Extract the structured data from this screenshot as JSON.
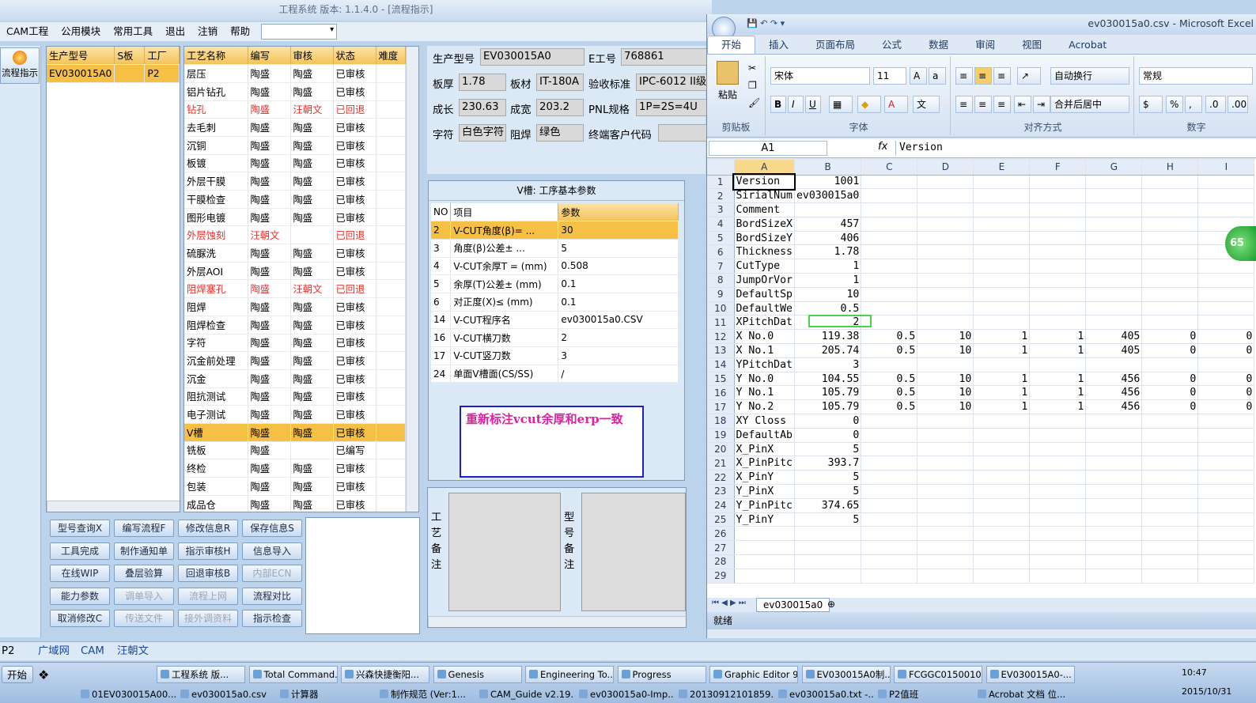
{
  "app": {
    "title": "工程系统   版本: 1.1.4.0 - [流程指示]"
  },
  "menu": [
    "CAM工程",
    "公用模块",
    "常用工具",
    "退出",
    "注销",
    "帮助"
  ],
  "left": {
    "flow_btn": "流程指示"
  },
  "models": {
    "headers": [
      "生产型号",
      "S板",
      "工厂"
    ],
    "rows": [
      [
        "EV030015A0",
        "",
        "P2"
      ]
    ]
  },
  "process": {
    "headers": [
      "工艺名称",
      "编写",
      "审核",
      "状态",
      "难度"
    ],
    "rows": [
      {
        "c": [
          "层压",
          "陶盛",
          "陶盛",
          "已审核"
        ],
        "t": ""
      },
      {
        "c": [
          "铝片钻孔",
          "陶盛",
          "陶盛",
          "已审核"
        ],
        "t": ""
      },
      {
        "c": [
          "钻孔",
          "陶盛",
          "汪朝文",
          "已回退"
        ],
        "t": "red"
      },
      {
        "c": [
          "去毛刺",
          "陶盛",
          "陶盛",
          "已审核"
        ],
        "t": ""
      },
      {
        "c": [
          "沉铜",
          "陶盛",
          "陶盛",
          "已审核"
        ],
        "t": ""
      },
      {
        "c": [
          "板镀",
          "陶盛",
          "陶盛",
          "已审核"
        ],
        "t": ""
      },
      {
        "c": [
          "外层干膜",
          "陶盛",
          "陶盛",
          "已审核"
        ],
        "t": ""
      },
      {
        "c": [
          "干膜检查",
          "陶盛",
          "陶盛",
          "已审核"
        ],
        "t": ""
      },
      {
        "c": [
          "图形电镀",
          "陶盛",
          "陶盛",
          "已审核"
        ],
        "t": ""
      },
      {
        "c": [
          "外层蚀刻",
          "汪朝文",
          "",
          "已回退"
        ],
        "t": "red"
      },
      {
        "c": [
          "硫脲洗",
          "陶盛",
          "陶盛",
          "已审核"
        ],
        "t": ""
      },
      {
        "c": [
          "外层AOI",
          "陶盛",
          "陶盛",
          "已审核"
        ],
        "t": ""
      },
      {
        "c": [
          "阻焊塞孔",
          "陶盛",
          "汪朝文",
          "已回退"
        ],
        "t": "red"
      },
      {
        "c": [
          "阻焊",
          "陶盛",
          "陶盛",
          "已审核"
        ],
        "t": ""
      },
      {
        "c": [
          "阻焊检查",
          "陶盛",
          "陶盛",
          "已审核"
        ],
        "t": ""
      },
      {
        "c": [
          "字符",
          "陶盛",
          "陶盛",
          "已审核"
        ],
        "t": ""
      },
      {
        "c": [
          "沉金前处理",
          "陶盛",
          "陶盛",
          "已审核"
        ],
        "t": ""
      },
      {
        "c": [
          "沉金",
          "陶盛",
          "陶盛",
          "已审核"
        ],
        "t": ""
      },
      {
        "c": [
          "阻抗测试",
          "陶盛",
          "陶盛",
          "已审核"
        ],
        "t": ""
      },
      {
        "c": [
          "电子测试",
          "陶盛",
          "陶盛",
          "已审核"
        ],
        "t": ""
      },
      {
        "c": [
          "V槽",
          "陶盛",
          "陶盛",
          "已审核"
        ],
        "t": "sel"
      },
      {
        "c": [
          "铣板",
          "陶盛",
          "",
          "已编写"
        ],
        "t": ""
      },
      {
        "c": [
          "终检",
          "陶盛",
          "陶盛",
          "已审核"
        ],
        "t": ""
      },
      {
        "c": [
          "包装",
          "陶盛",
          "陶盛",
          "已审核"
        ],
        "t": ""
      },
      {
        "c": [
          "成品仓",
          "陶盛",
          "陶盛",
          "已审核"
        ],
        "t": ""
      }
    ]
  },
  "buttons": [
    {
      "l": "型号查询X",
      "d": false
    },
    {
      "l": "编写流程F",
      "d": false
    },
    {
      "l": "修改信息R",
      "d": false
    },
    {
      "l": "保存信息S",
      "d": false
    },
    {
      "l": "工具完成",
      "d": false
    },
    {
      "l": "制作通知单",
      "d": false
    },
    {
      "l": "指示审核H",
      "d": false
    },
    {
      "l": "信息导入",
      "d": false
    },
    {
      "l": "在线WIP",
      "d": false
    },
    {
      "l": "叠层验算",
      "d": false
    },
    {
      "l": "回退审核B",
      "d": false
    },
    {
      "l": "内部ECN",
      "d": true
    },
    {
      "l": "能力参数",
      "d": false
    },
    {
      "l": "调单导入",
      "d": true
    },
    {
      "l": "流程上网",
      "d": true
    },
    {
      "l": "流程对比",
      "d": false
    },
    {
      "l": "取消修改C",
      "d": false
    },
    {
      "l": "传送文件",
      "d": true
    },
    {
      "l": "接外调资料",
      "d": true
    },
    {
      "l": "指示检查",
      "d": false
    }
  ],
  "info": {
    "model_label": "生产型号",
    "model": "EV030015A0",
    "e_label": "E工号",
    "e": "768861",
    "thick_label": "板厚",
    "thick": "1.78",
    "mat_label": "板材",
    "mat": "IT-180A",
    "std_label": "验收标准",
    "std": "IPC-6012 II级",
    "len_label": "成长",
    "len": "230.63",
    "wid_label": "成宽",
    "wid": "203.2",
    "pnl_label": "PNL规格",
    "pnl": "1P=2S=4U",
    "char_label": "字符",
    "char": "白色字符",
    "mask_label": "阻焊",
    "mask": "绿色",
    "cust_label": "终端客户代码",
    "cust": ""
  },
  "vcut": {
    "title": "V槽: 工序基本参数",
    "headers": [
      "NO",
      "项目",
      "参数"
    ],
    "rows": [
      [
        "2",
        "V-CUT角度(β)=  ...",
        "30"
      ],
      [
        "3",
        "角度(β)公差±  ...",
        "5"
      ],
      [
        "4",
        "V-CUT余厚T =  (mm)",
        "0.508"
      ],
      [
        "5",
        "余厚(T)公差±  (mm)",
        "0.1"
      ],
      [
        "6",
        "对正度(X)≤  (mm)",
        "0.1"
      ],
      [
        "14",
        "V-CUT程序名",
        "ev030015a0.CSV"
      ],
      [
        "16",
        "V-CUT横刀数",
        "2"
      ],
      [
        "17",
        "V-CUT竖刀数",
        "3"
      ],
      [
        "24",
        "单面V槽面(CS/SS)",
        "/"
      ]
    ]
  },
  "note": "重新标注vcut余厚和erp一致",
  "remarks": {
    "process": "工艺备注",
    "model": "型号备注"
  },
  "excel": {
    "title": "ev030015a0.csv - Microsoft Excel",
    "tabs": [
      "开始",
      "插入",
      "页面布局",
      "公式",
      "数据",
      "审阅",
      "视图",
      "Acrobat"
    ],
    "paste": "粘贴",
    "clipboard": "剪贴板",
    "font": "宋体",
    "size": "11",
    "font_grp": "字体",
    "wrap": "自动换行",
    "merge": "合并后居中",
    "align_grp": "对齐方式",
    "numfmt": "常规",
    "num_grp": "数字",
    "namebox": "A1",
    "fx": "fx",
    "formula": "Version",
    "cols": [
      "A",
      "B",
      "C",
      "D",
      "E",
      "F",
      "G",
      "H",
      "I"
    ],
    "rows": [
      [
        "Version",
        "1001"
      ],
      [
        "SirialNum",
        "ev030015a0"
      ],
      [
        "Comment",
        ""
      ],
      [
        "BordSizeX",
        "457"
      ],
      [
        "BordSizeY",
        "406"
      ],
      [
        "Thickness",
        "1.78"
      ],
      [
        "CutType",
        "1"
      ],
      [
        "JumpOrVor",
        "1"
      ],
      [
        "DefaultSp",
        "10"
      ],
      [
        "DefaultWe",
        "0.5"
      ],
      [
        "XPitchDat",
        "2"
      ],
      [
        "X No.0",
        "119.38",
        "0.5",
        "10",
        "1",
        "1",
        "405",
        "0",
        "0"
      ],
      [
        "X No.1",
        "205.74",
        "0.5",
        "10",
        "1",
        "1",
        "405",
        "0",
        "0"
      ],
      [
        "YPitchDat",
        "3"
      ],
      [
        "Y No.0",
        "104.55",
        "0.5",
        "10",
        "1",
        "1",
        "456",
        "0",
        "0"
      ],
      [
        "Y No.1",
        "105.79",
        "0.5",
        "10",
        "1",
        "1",
        "456",
        "0",
        "0"
      ],
      [
        "Y No.2",
        "105.79",
        "0.5",
        "10",
        "1",
        "1",
        "456",
        "0",
        "0"
      ],
      [
        "XY Closs",
        "0"
      ],
      [
        "DefaultAb",
        "0"
      ],
      [
        "X_PinX",
        "5"
      ],
      [
        "X_PinPitc",
        "393.7"
      ],
      [
        "X_PinY",
        "5"
      ],
      [
        "Y_PinX",
        "5"
      ],
      [
        "Y_PinPitc",
        "374.65"
      ],
      [
        "Y_PinY",
        "5"
      ],
      [
        ""
      ],
      [
        ""
      ],
      [
        ""
      ],
      [
        ""
      ]
    ],
    "sheet": "ev030015a0",
    "status": "就绪",
    "bubble": "65"
  },
  "bottom": [
    "P2",
    "广域网",
    "CAM",
    "汪朝文"
  ],
  "taskbar": {
    "start": "开始",
    "row1": [
      "工程系统  版...",
      "Total Command...",
      "兴森快捷衡阳...",
      "Genesis",
      "Engineering To...",
      "Progress",
      "Graphic Editor 9...",
      "EV030015A0制...",
      "FCGGC0150010...",
      "EV030015A0-..."
    ],
    "row2": [
      "01EV030015A00...",
      "ev030015a0.csv",
      "计算器",
      "制作规范 (Ver:1...",
      "CAM_Guide v2.19...",
      "ev030015a0-Imp...",
      "20130912101859...",
      "ev030015a0.txt -...",
      "P2值班",
      "Acrobat 文档 位..."
    ],
    "time": "10:47",
    "date": "2015/10/31"
  }
}
